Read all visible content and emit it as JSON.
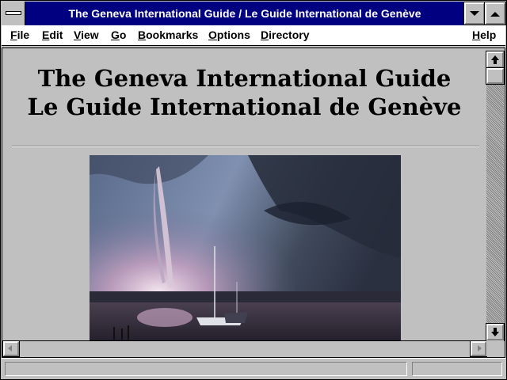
{
  "window": {
    "title": "The Geneva International Guide / Le Guide International de Genève",
    "minimize_icon": "down-triangle",
    "maximize_icon": "up-down-triangle"
  },
  "menubar": {
    "items": [
      {
        "accel": "F",
        "rest": "ile"
      },
      {
        "accel": "E",
        "rest": "dit"
      },
      {
        "accel": "V",
        "rest": "iew"
      },
      {
        "accel": "G",
        "rest": "o"
      },
      {
        "accel": "B",
        "rest": "ookmarks"
      },
      {
        "accel": "O",
        "rest": "ptions"
      },
      {
        "accel": "D",
        "rest": "irectory"
      },
      {
        "accel": "H",
        "rest": "elp"
      }
    ]
  },
  "page": {
    "heading_line1": "The Geneva International Guide",
    "heading_line2": "Le Guide International de Genève",
    "image_subject": "Jet d'Eau fountain with sailboat on Lake Geneva at dusk"
  },
  "scrollbars": {
    "up_icon": "arrow-up-icon",
    "down_icon": "arrow-down-icon",
    "left_icon": "arrow-left-icon",
    "right_icon": "arrow-right-icon"
  },
  "statusbar": {
    "text": ""
  }
}
